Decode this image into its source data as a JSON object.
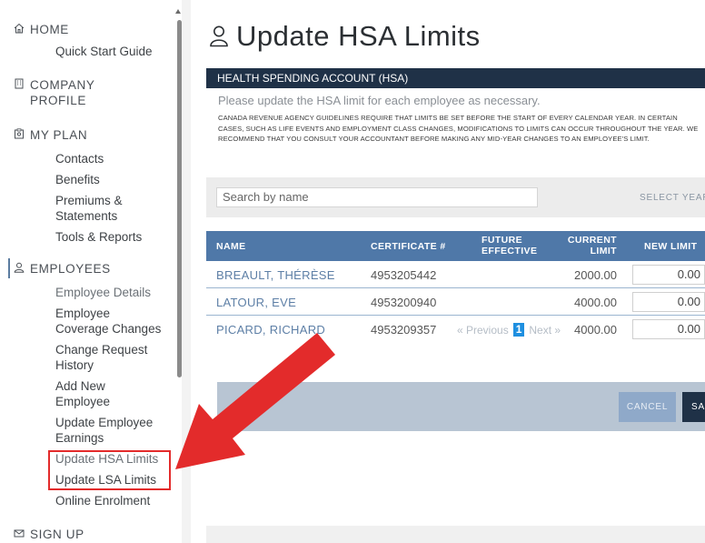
{
  "sidebar": {
    "home": {
      "label": "HOME",
      "links": [
        "Quick Start Guide"
      ]
    },
    "company": {
      "label": "COMPANY PROFILE",
      "line1": "COMPANY",
      "line2": "PROFILE"
    },
    "plan": {
      "label": "MY PLAN",
      "links": [
        "Contacts",
        "Benefits",
        "Premiums &",
        "Statements",
        "Tools & Reports"
      ]
    },
    "employees": {
      "label": "EMPLOYEES",
      "links": [
        "Employee Details",
        "Employee",
        "Coverage Changes",
        "Change Request",
        "History",
        "Add New",
        "Employee",
        "Update Employee",
        "Earnings",
        "Update HSA Limits",
        "Update LSA Limits",
        "Online Enrolment"
      ]
    },
    "signup": {
      "label": "SIGN UP"
    }
  },
  "page": {
    "title": "Update HSA Limits",
    "section": "HEALTH SPENDING ACCOUNT (HSA)",
    "intro": "Please update the HSA limit for each employee as necessary.",
    "notice": "CANADA REVENUE AGENCY GUIDELINES REQUIRE THAT LIMITS BE SET BEFORE THE START OF EVERY CALENDAR YEAR. IN CERTAIN CASES, SUCH AS LIFE EVENTS AND EMPLOYMENT CLASS CHANGES, MODIFICATIONS TO LIMITS CAN OCCUR THROUGHOUT THE YEAR. WE RECOMMEND THAT YOU CONSULT YOUR ACCOUNTANT BEFORE MAKING ANY MID-YEAR CHANGES TO AN EMPLOYEE'S LIMIT."
  },
  "search": {
    "placeholder": "Search by name",
    "select_year": "SELECT YEAR"
  },
  "table": {
    "headers": {
      "name": "NAME",
      "certificate": "CERTIFICATE #",
      "future1": "FUTURE",
      "future2": "EFFECTIVE",
      "current1": "CURRENT",
      "current2": "LIMIT",
      "new": "NEW LIMIT"
    },
    "rows": [
      {
        "name": "BREAULT, THÉRÈSE",
        "certificate": "4953205442",
        "current_limit": "2000.00",
        "new_limit": "0.00"
      },
      {
        "name": "LATOUR, EVE",
        "certificate": "4953200940",
        "current_limit": "4000.00",
        "new_limit": "0.00"
      },
      {
        "name": "PICARD, RICHARD",
        "certificate": "4953209357",
        "current_limit": "4000.00",
        "new_limit": "0.00"
      }
    ]
  },
  "pager": {
    "prev": "« Previous",
    "page": "1",
    "next": "Next »"
  },
  "actions": {
    "cancel": "CANCEL",
    "save": "SA"
  },
  "colors": {
    "navy": "#1f3147",
    "table_header": "#4f78a8",
    "highlight": "#e32b2b",
    "page_active": "#1e8fe0"
  }
}
